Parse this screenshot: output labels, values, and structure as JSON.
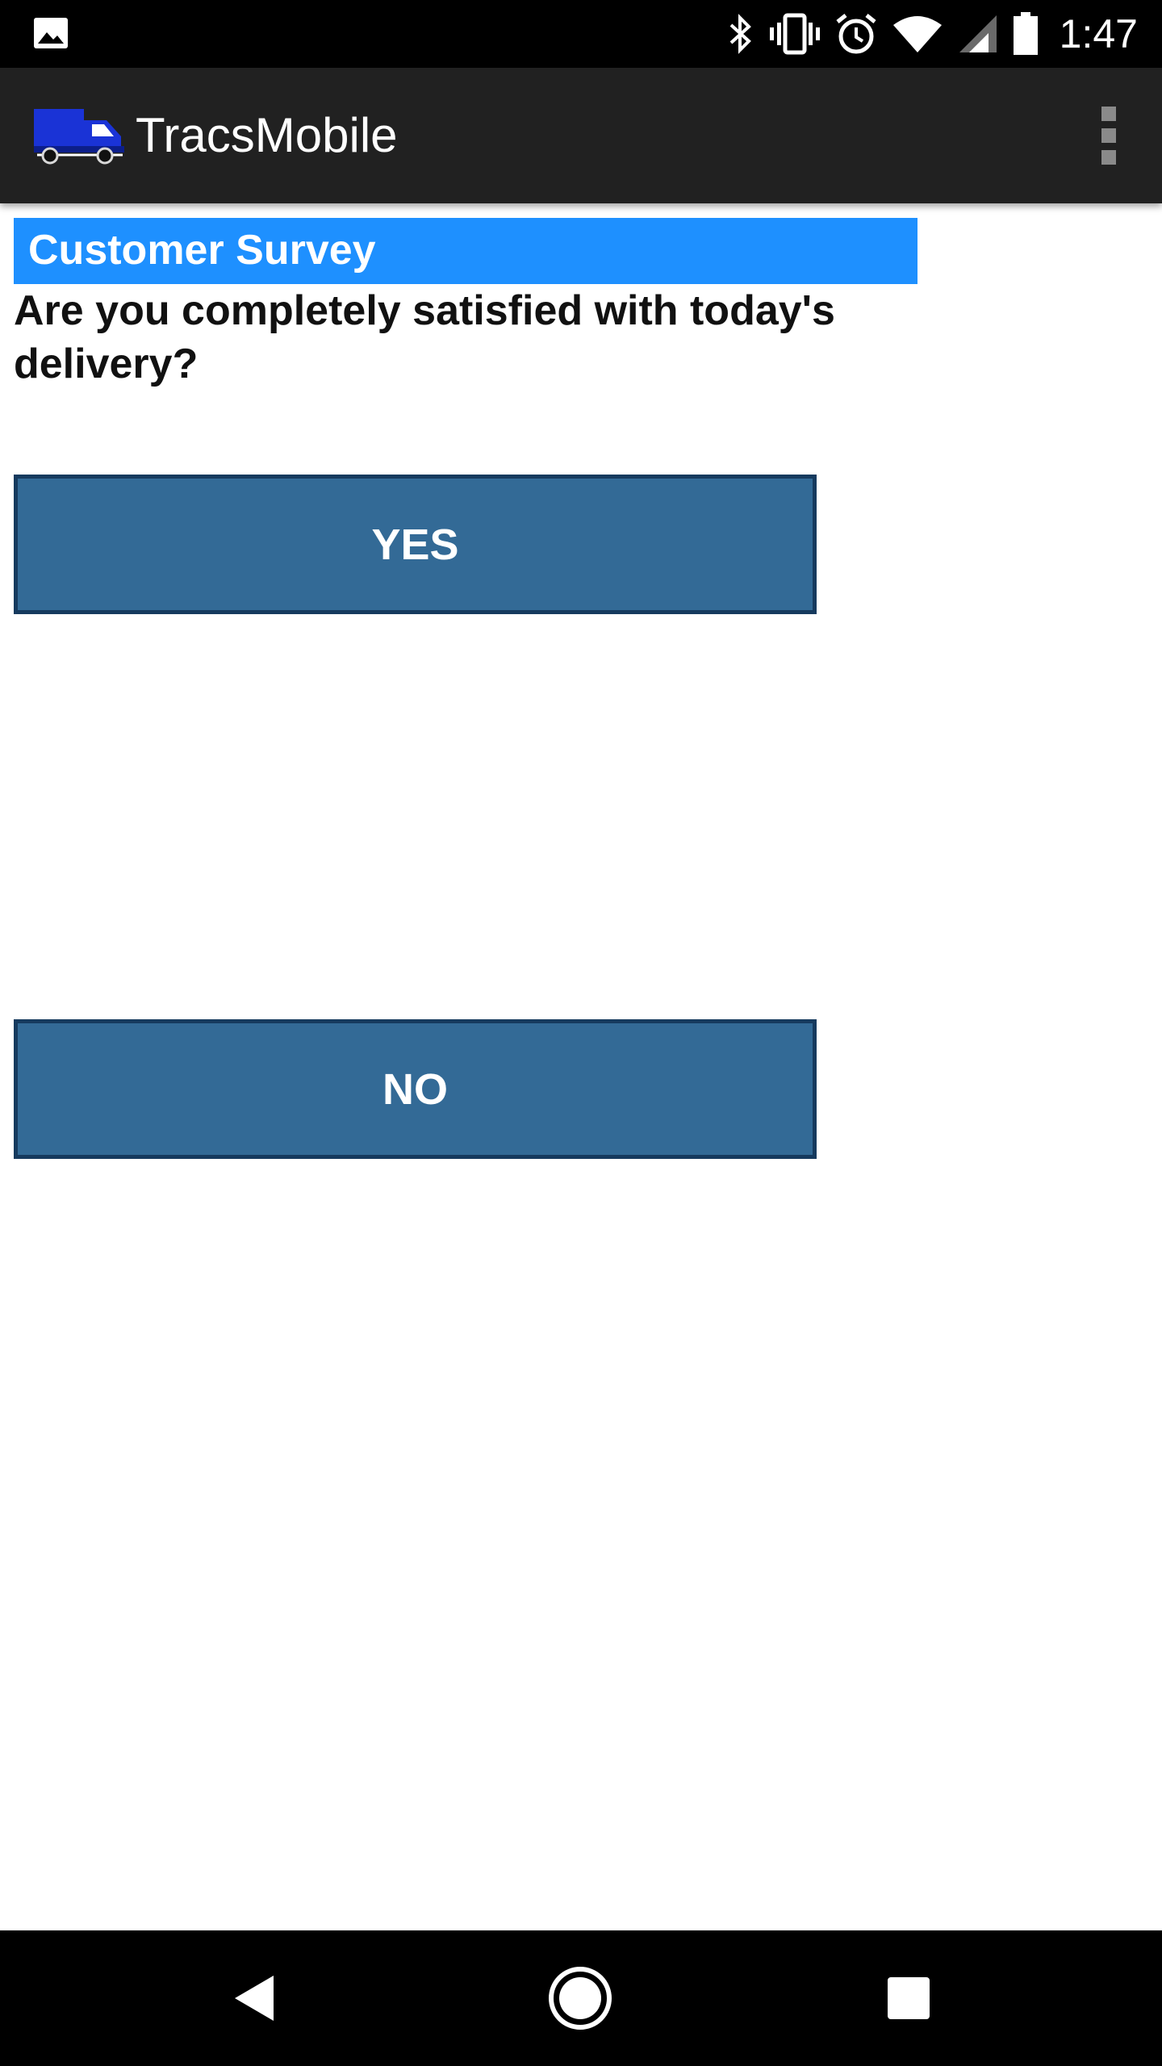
{
  "status_bar": {
    "time": "1:47",
    "icons": [
      "gallery-icon",
      "bluetooth-icon",
      "vibrate-icon",
      "alarm-icon",
      "wifi-icon",
      "signal-icon",
      "battery-icon"
    ]
  },
  "app_bar": {
    "title": "TracsMobile",
    "logo_icon": "truck-icon",
    "menu_icon": "overflow-menu-icon"
  },
  "survey": {
    "header": "Customer Survey",
    "question": "Are you completely satisfied with today's delivery?",
    "yes_label": "YES",
    "no_label": "NO"
  },
  "nav_bar": {
    "icons": [
      "back-icon",
      "home-icon",
      "recents-icon"
    ]
  },
  "colors": {
    "app_bar": "#212121",
    "header_bg": "#1e90ff",
    "button_bg": "#336a96",
    "button_border": "#163a5e"
  }
}
